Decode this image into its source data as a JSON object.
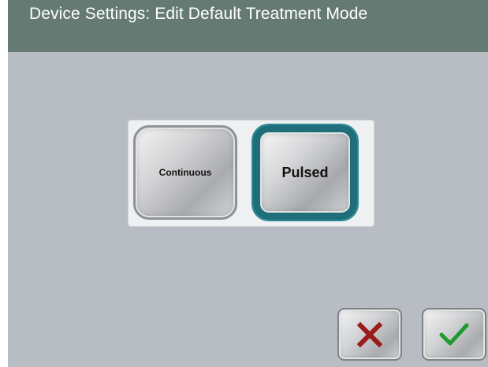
{
  "header": {
    "title": "Device Settings: Edit Default Treatment Mode"
  },
  "modes": {
    "options": [
      {
        "label": "Continuous",
        "selected": false
      },
      {
        "label": "Pulsed",
        "selected": true
      }
    ],
    "selected": "Pulsed"
  },
  "actions": {
    "cancel_icon": "x-icon",
    "confirm_icon": "checkmark-icon"
  },
  "colors": {
    "title_bar": "#647a72",
    "background": "#b8bcc3",
    "selected_border": "#1e6f7a",
    "cancel_icon": "#9b1a1a",
    "confirm_icon": "#1f9a2e"
  }
}
